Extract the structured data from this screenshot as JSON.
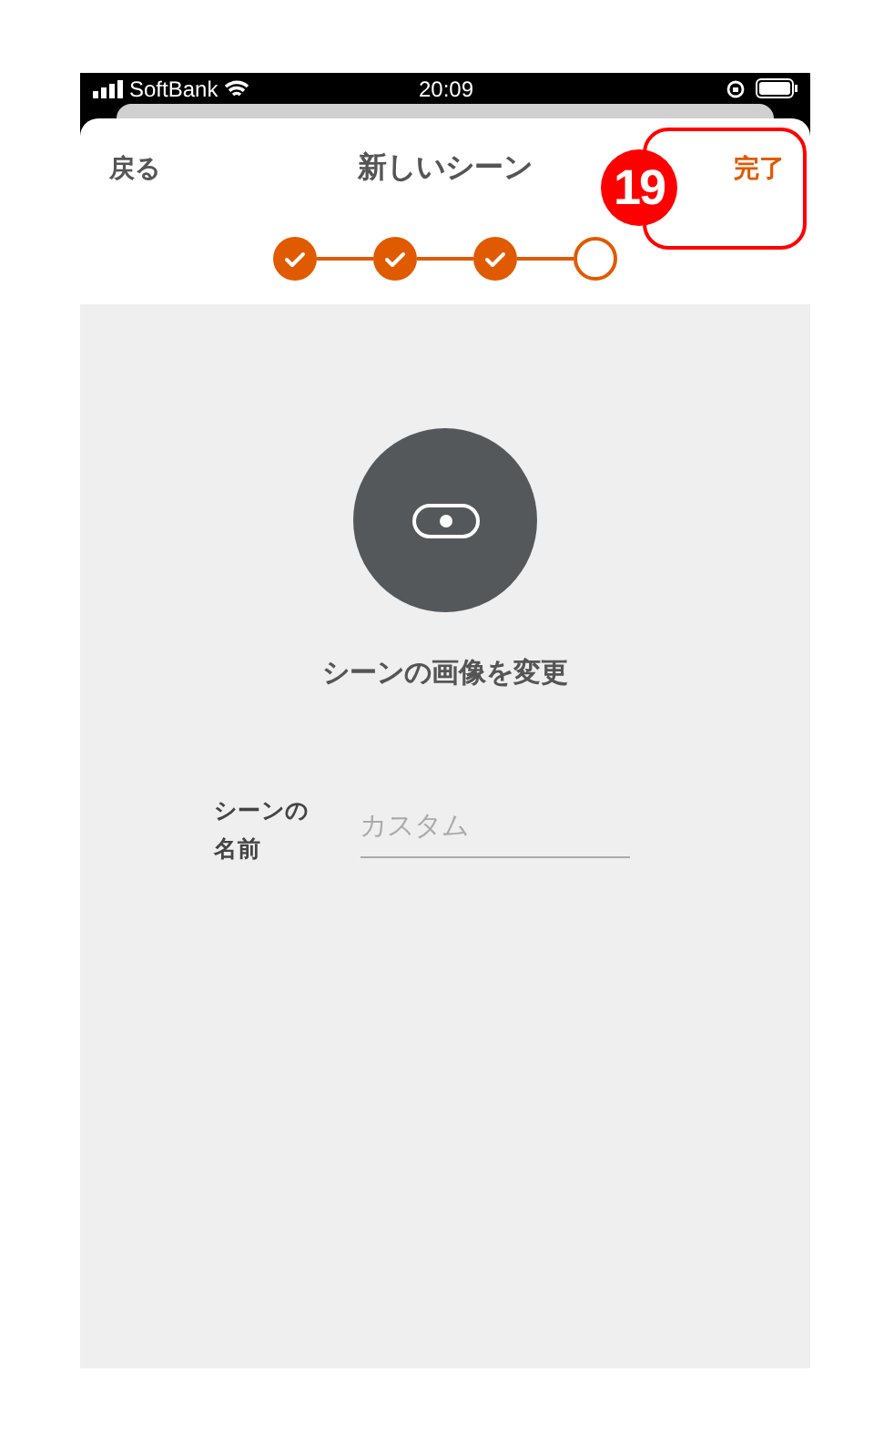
{
  "status_bar": {
    "carrier": "SoftBank",
    "time": "20:09"
  },
  "header": {
    "back": "戻る",
    "title": "新しいシーン",
    "done": "完了"
  },
  "steps": [
    {
      "checked": true
    },
    {
      "checked": true
    },
    {
      "checked": true
    },
    {
      "checked": false
    }
  ],
  "image_button": {
    "label": "シーンの画像を変更"
  },
  "name_field": {
    "label": "シーンの名前",
    "placeholder": "カスタム"
  },
  "annotation": {
    "number": "19"
  }
}
